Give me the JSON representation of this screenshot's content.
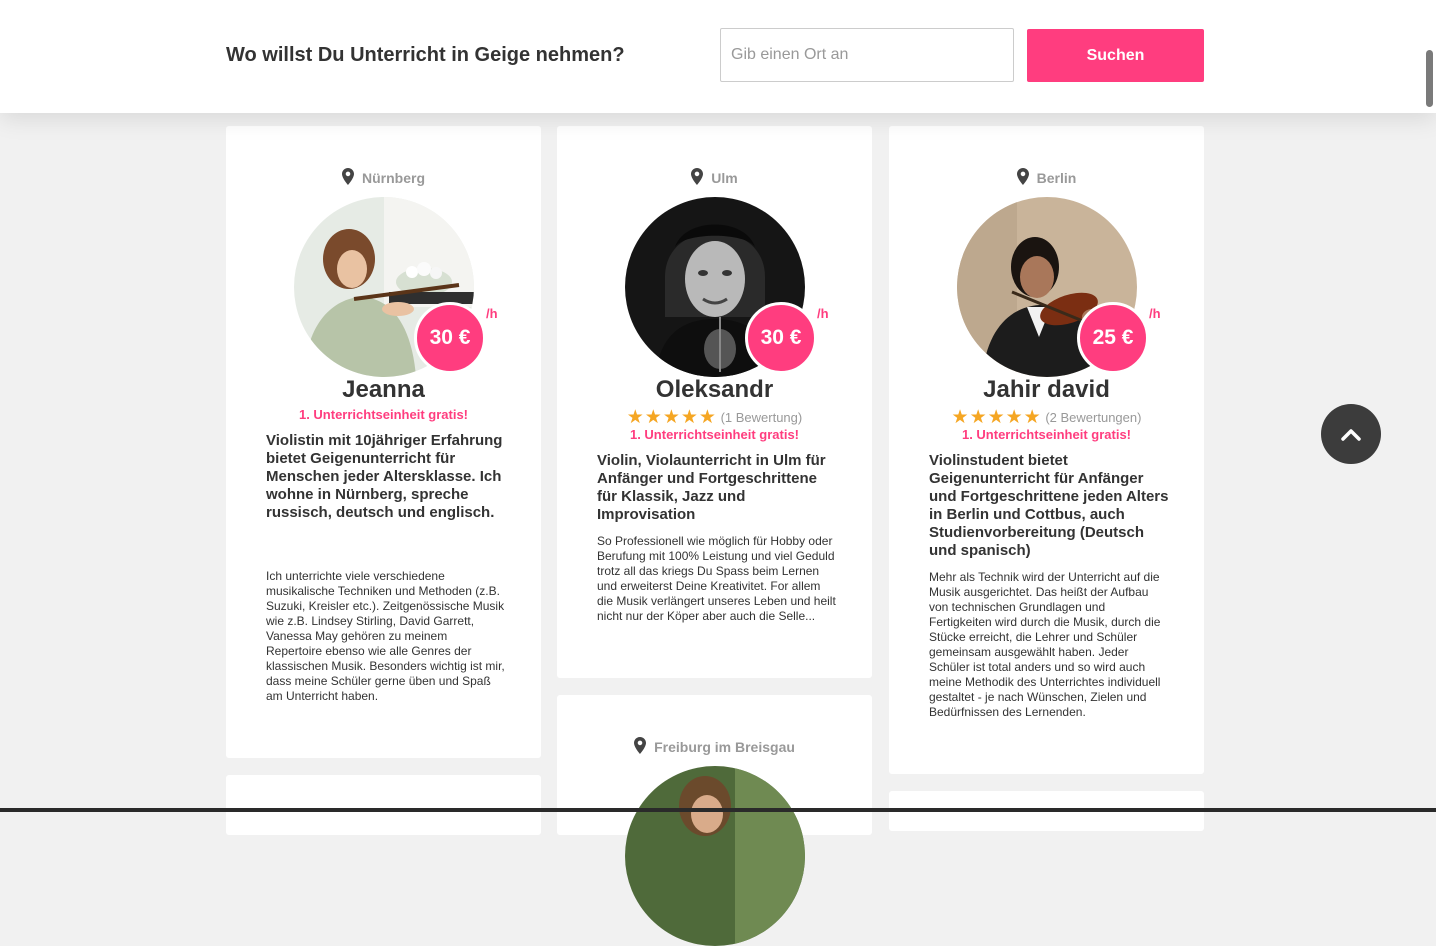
{
  "header": {
    "question": "Wo willst Du Unterricht in Geige nehmen?",
    "search_placeholder": "Gib einen Ort an",
    "search_button": "Suchen"
  },
  "per_hour": "/h",
  "free_lesson": "1. Unterrichtseinheit gratis!",
  "teachers": [
    {
      "location": "Nürnberg",
      "price": "30 €",
      "name": "Jeanna",
      "headline": "Violistin mit 10jähriger Erfahrung bietet Geigenunterricht für Menschen jeder Altersklasse. Ich wohne in Nürnberg, spreche russisch, deutsch und englisch.",
      "description": "Ich unterrichte viele verschiedene musikalische Techniken und Methoden (z.B. Suzuki, Kreisler etc.). Zeitgenössische Musik wie z.B. Lindsey Stirling, David Garrett, Vanessa May gehören zu meinem Repertoire ebenso wie alle Genres der klassischen Musik. Besonders wichtig ist mir, dass meine Schüler gerne üben und Spaß am Unterricht haben."
    },
    {
      "location": "Ulm",
      "price": "30 €",
      "name": "Oleksandr",
      "stars": "★★★★★",
      "reviews": "(1 Bewertung)",
      "headline": "Violin, Violaunterricht in Ulm für Anfänger und Fortgeschrittene für Klassik, Jazz und Improvisation",
      "description": "So Professionell wie möglich für Hobby oder Berufung mit 100% Leistung und viel Geduld trotz all das kriegs Du Spass beim Lernen und erweiterst Deine Kreativitet. For allem die Musik verlängert unseres Leben und heilt nicht nur der Köper aber auch die Selle..."
    },
    {
      "location": "Berlin",
      "price": "25 €",
      "name": "Jahir david",
      "stars": "★★★★★",
      "reviews": "(2 Bewertungen)",
      "headline": "Violinstudent bietet Geigenunterricht für Anfänger und Fortgeschrittene jeden Alters in Berlin und Cottbus, auch Studienvorbereitung (Deutsch und spanisch)",
      "description": "Mehr als Technik wird der Unterricht auf die Musik ausgerichtet. Das heißt der Aufbau von technischen Grundlagen und Fertigkeiten wird durch die Musik, durch die Stücke erreicht, die Lehrer und Schüler gemeinsam ausgewählt haben. Jeder Schüler ist total anders und so wird auch meine Methodik des Unterrichtes individuell gestaltet - je nach Wünschen, Zielen und Bedürfnissen des Lernenden."
    },
    {
      "location": "Freiburg im Breisgau"
    }
  ],
  "icons": {
    "location": "location-pin-icon",
    "scroll_up": "chevron-up-icon"
  },
  "colors": {
    "accent": "#ff3d7f",
    "star": "#f5a623"
  }
}
